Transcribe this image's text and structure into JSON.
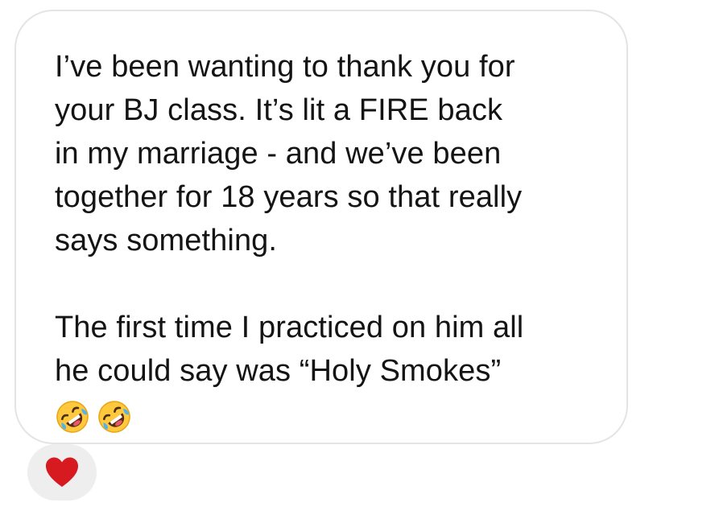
{
  "message": {
    "paragraph_1": "I’ve been wanting to thank you for\nyour BJ class. It’s lit a FIRE back\nin my marriage - and we’ve been\ntogether for 18 years so that really\nsays something.",
    "paragraph_2": "The first time I practiced on him all\nhe could say was “Holy Smokes”",
    "emojis": [
      "rolling-on-floor-laughing",
      "rolling-on-floor-laughing"
    ]
  },
  "reaction": {
    "icon": "heart-icon",
    "color": "#d71920"
  },
  "colors": {
    "bubble_border": "#e4e4e4",
    "text": "#141414",
    "reaction_bg": "#eeeeee"
  }
}
